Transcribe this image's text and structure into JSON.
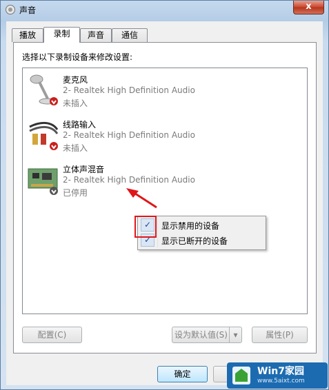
{
  "window": {
    "title": "声音",
    "close": "x"
  },
  "tabs": [
    {
      "label": "播放",
      "active": false
    },
    {
      "label": "录制",
      "active": true
    },
    {
      "label": "声音",
      "active": false
    },
    {
      "label": "通信",
      "active": false
    }
  ],
  "panel": {
    "instruction": "选择以下录制设备来修改设置:"
  },
  "devices": [
    {
      "name": "麦克风",
      "desc": "2- Realtek High Definition Audio",
      "status": "未插入",
      "icon": "microphone-icon"
    },
    {
      "name": "线路输入",
      "desc": "2- Realtek High Definition Audio",
      "status": "未插入",
      "icon": "line-in-cable-icon"
    },
    {
      "name": "立体声混音",
      "desc": "2- Realtek High Definition Audio",
      "status": "已停用",
      "icon": "sound-card-icon"
    }
  ],
  "context_menu": {
    "items": [
      {
        "label": "显示禁用的设备",
        "checked": true
      },
      {
        "label": "显示已断开的设备",
        "checked": true
      }
    ]
  },
  "buttons": {
    "configure": "配置(C)",
    "set_default": "设为默认值(S)",
    "properties": "属性(P)",
    "ok": "确定"
  },
  "watermark": {
    "brand": "Win7家园",
    "site": "www.5aixt.com"
  },
  "colors": {
    "highlight_box": "#e0161a",
    "arrow": "#e0161a",
    "status_badge": "#c8201e"
  }
}
